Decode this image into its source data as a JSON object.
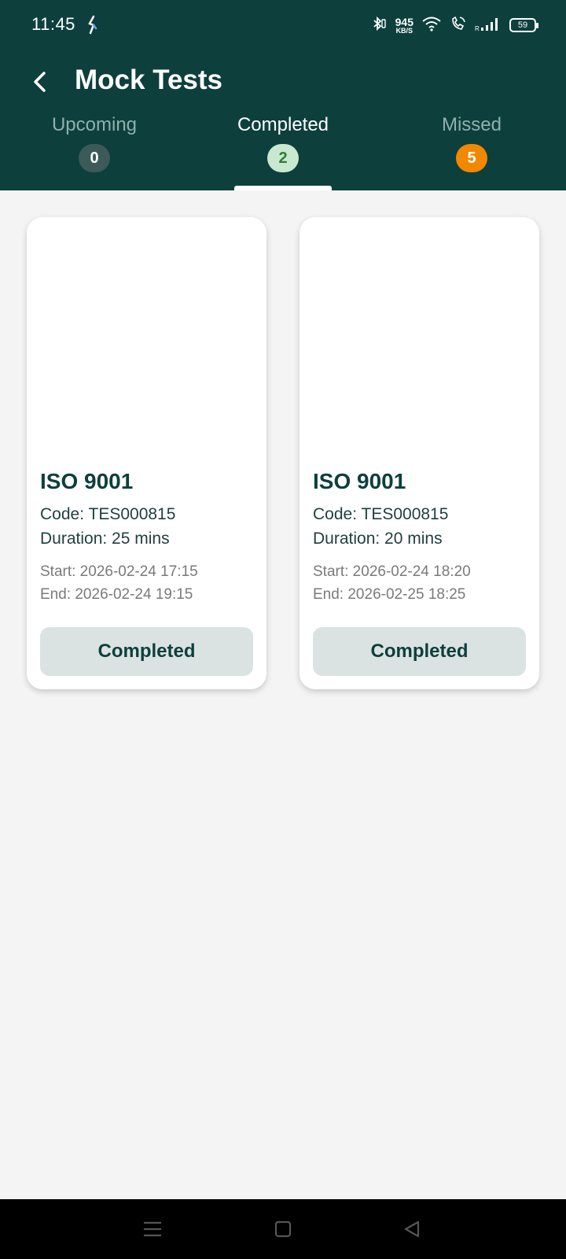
{
  "status_bar": {
    "time": "11:45",
    "net_speed_value": "945",
    "net_speed_unit": "KB/S",
    "battery": "59",
    "icons": [
      "bluetooth-icon",
      "wifi-icon",
      "call-icon",
      "signal-icon",
      "battery-icon"
    ]
  },
  "app_bar": {
    "title": "Mock Tests",
    "back_icon": "chevron-left-icon"
  },
  "tabs": [
    {
      "label": "Upcoming",
      "count": "0",
      "active": false
    },
    {
      "label": "Completed",
      "count": "2",
      "active": true
    },
    {
      "label": "Missed",
      "count": "5",
      "active": false
    }
  ],
  "cards": [
    {
      "title": "ISO 9001",
      "code": "Code: TES000815",
      "duration": "Duration: 25 mins",
      "start": "Start: 2026-02-24 17:15",
      "end": "End: 2026-02-24 19:15",
      "status": "Completed"
    },
    {
      "title": "ISO 9001",
      "code": "Code: TES000815",
      "duration": "Duration: 20 mins",
      "start": "Start: 2026-02-24 18:20",
      "end": "End: 2026-02-25 18:25",
      "status": "Completed"
    }
  ],
  "colors": {
    "header": "#0d3f3d",
    "background": "#f4f4f4",
    "missed_badge": "#f18800",
    "completed_badge": "#c8e8cf",
    "status_button": "#dbe3e2"
  },
  "nav_bar": {
    "icons": [
      "menu-icon",
      "home-icon",
      "back-triangle-icon"
    ]
  }
}
